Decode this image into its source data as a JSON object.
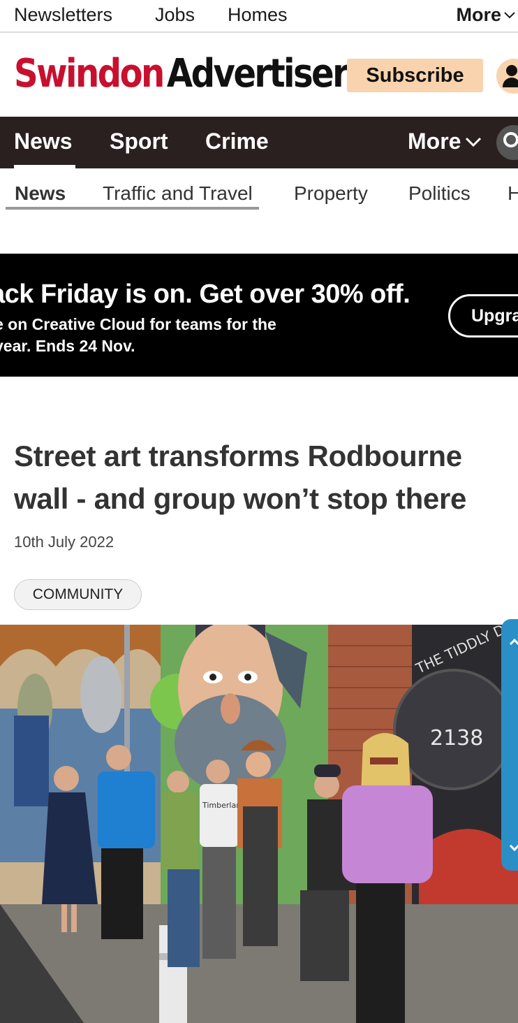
{
  "utility_bar": {
    "items": [
      "Newsletters",
      "Jobs",
      "Homes"
    ],
    "more_label": "More"
  },
  "masthead": {
    "logo_part1": "Swindon",
    "logo_part2": "Advertiser",
    "subscribe_label": "Subscribe"
  },
  "main_nav": {
    "items": [
      "News",
      "Sport",
      "Crime"
    ],
    "more_label": "More"
  },
  "sub_nav": {
    "items": [
      "News",
      "Traffic and Travel",
      "Property",
      "Politics",
      "H"
    ]
  },
  "ad": {
    "headline": "ack Friday is on. Get over 30% off.",
    "line1": "e on Creative Cloud for teams for the",
    "line2": "year. Ends 24 Nov.",
    "button_label": "Upgra"
  },
  "article": {
    "headline": "Street art transforms Rodbourne wall - and group won’t stop there",
    "date": "10th July 2022",
    "tag": "COMMUNITY"
  },
  "hero_image": {
    "mural_text_1": "THE TIDDLY DI",
    "mural_text_2": "2138",
    "shirt_text": "Timberland"
  },
  "colors": {
    "brand_red": "#c8102e",
    "nav_bg": "#2a201f",
    "subscribe_bg": "#f9d3ad",
    "side_tab": "#2a8fc7"
  }
}
